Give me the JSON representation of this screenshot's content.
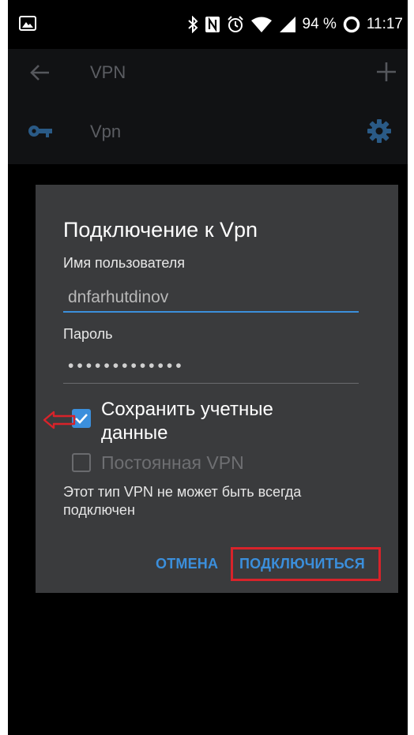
{
  "status_bar": {
    "battery": "94 %",
    "time": "11:17",
    "icons": [
      "gallery-icon",
      "bluetooth-icon",
      "nfc-icon",
      "alarm-icon",
      "wifi-icon",
      "signal-icon",
      "battery-ring-icon"
    ]
  },
  "toolbar": {
    "title": "VPN",
    "back_icon": "arrow-left-icon",
    "add_icon": "plus-icon"
  },
  "vpn_list": {
    "items": [
      {
        "name": "Vpn",
        "icon": "key-icon",
        "settings_icon": "gear-icon"
      }
    ]
  },
  "dialog": {
    "title": "Подключение к Vpn",
    "username_label": "Имя пользователя",
    "username_value": "dnfarhutdinov",
    "password_label": "Пароль",
    "password_value": "•••••••••••••",
    "save_credentials_label_line1": "Сохранить учетные",
    "save_credentials_label_line2": "данные",
    "save_credentials_checked": true,
    "always_on_label": "Постоянная VPN",
    "always_on_checked": false,
    "note": "Этот тип VPN не может быть всегда подключен",
    "cancel_button": "ОТМЕНА",
    "connect_button": "ПОДКЛЮЧИТЬСЯ"
  },
  "colors": {
    "accent": "#3b8fdc",
    "dialog_bg": "#3a3b3d",
    "annotation_red": "#d8232a"
  }
}
